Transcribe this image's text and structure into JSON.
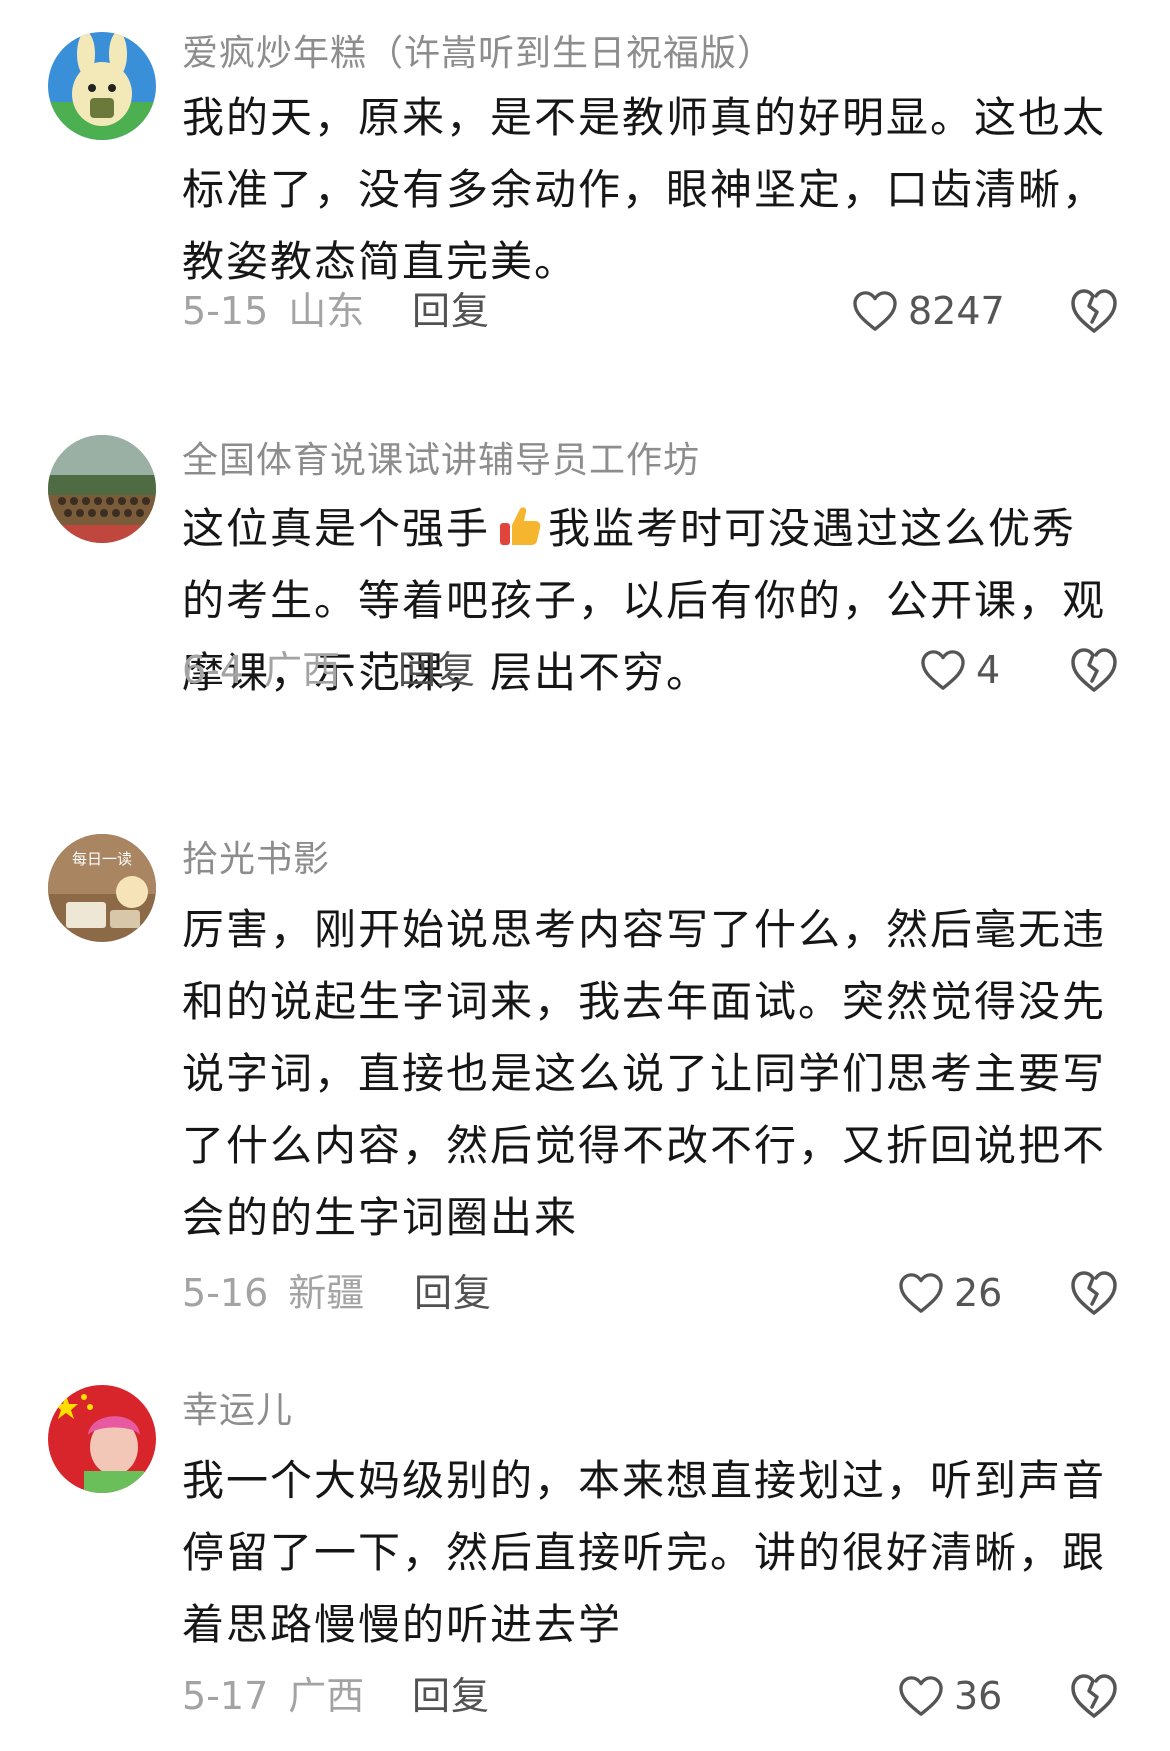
{
  "colors": {
    "username": "#8d8d8d",
    "content": "#161616",
    "meta": "#a3a3a3",
    "reply": "#525252",
    "icon": "#555555"
  },
  "comments": [
    {
      "username": "爱疯炒年糕（许嵩听到生日祝福版）",
      "lines": [
        "我的天，原来，是不是教师真的好明显。这也太",
        "标准了，没有多余动作，眼神坚定，口齿清晰，",
        "教姿教态简直完美。"
      ],
      "date": "5-15",
      "region": "山东",
      "reply": "回复",
      "likes": "8247",
      "avatar_icon": "cartoon-rabbit-avatar"
    },
    {
      "username": "全国体育说课试讲辅导员工作坊",
      "lines_b": {
        "l1_before": "这位真是个强手",
        "l1_after": "我监考时可没遇过这么优秀",
        "l2": "的考生。等着吧孩子，以后有你的，公开课，观",
        "l3": "摩课，示范课，层出不穷。"
      },
      "emoji": "thumbs-up-emoji",
      "date": "6-4",
      "region": "广西",
      "reply": "回复",
      "likes": "4",
      "avatar_icon": "group-photo-avatar"
    },
    {
      "username": "拾光书影",
      "lines": [
        "厉害，刚开始说思考内容写了什么，然后毫无违",
        "和的说起生字词来，我去年面试。突然觉得没先",
        "说字词，直接也是这么说了让同学们思考主要写",
        "了什么内容，然后觉得不改不行，又折回说把不",
        "会的的生字词圈出来"
      ],
      "avatar_text": "每日一读",
      "date": "5-16",
      "region": "新疆",
      "reply": "回复",
      "likes": "26",
      "avatar_icon": "book-photo-avatar"
    },
    {
      "username": "幸运儿",
      "lines": [
        "我一个大妈级别的，本来想直接划过，听到声音",
        "停留了一下，然后直接听完。讲的很好清晰，跟",
        "着思路慢慢的听进去学"
      ],
      "date": "5-17",
      "region": "广西",
      "reply": "回复",
      "likes": "36",
      "avatar_icon": "flag-portrait-avatar"
    }
  ],
  "icons": {
    "like": "heart-outline-icon",
    "dislike": "broken-heart-icon"
  }
}
